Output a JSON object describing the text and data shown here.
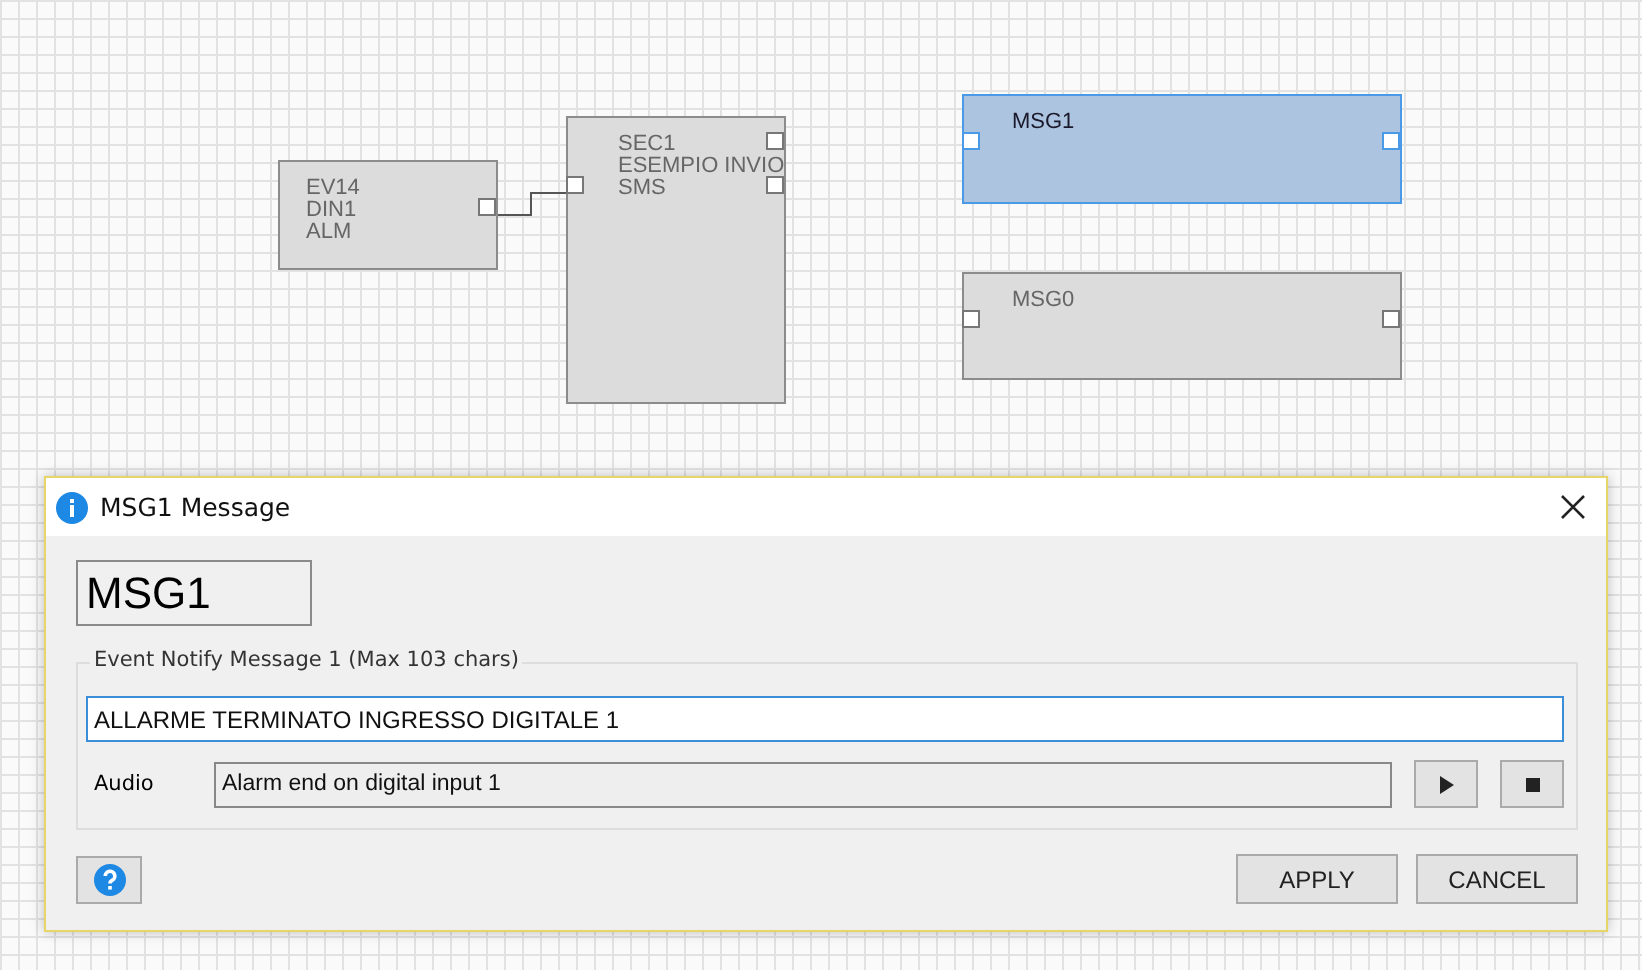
{
  "canvas": {
    "nodes": [
      {
        "lines": [
          "EV14",
          "DIN1",
          "ALM"
        ],
        "selected": false
      },
      {
        "lines": [
          "SEC1",
          "ESEMPIO INVIO",
          "SMS"
        ],
        "selected": false
      },
      {
        "lines": [
          "MSG1"
        ],
        "selected": true
      },
      {
        "lines": [
          "MSG0"
        ],
        "selected": false
      }
    ]
  },
  "dialog": {
    "title": "MSG1 Message",
    "name": "MSG1",
    "group_label": "Event Notify Message 1 (Max 103 chars)",
    "message": "ALLARME TERMINATO INGRESSO DIGITALE 1",
    "audio_label": "Audio",
    "audio_value": "Alarm end on digital input 1",
    "buttons": [
      "APPLY",
      "CANCEL"
    ]
  }
}
